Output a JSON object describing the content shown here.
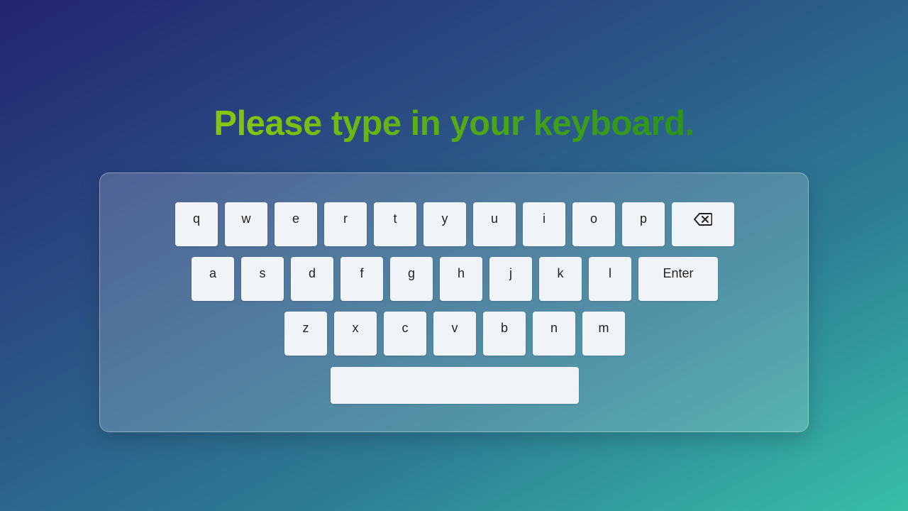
{
  "headline": "Please type in your keyboard.",
  "colors": {
    "headline_gradient_start": "#a6d60a",
    "headline_gradient_end": "#10801e",
    "key_background": "#f1f4f7",
    "key_text": "#222222"
  },
  "keyboard": {
    "row1": [
      "q",
      "w",
      "e",
      "r",
      "t",
      "y",
      "u",
      "i",
      "o",
      "p"
    ],
    "row2": [
      "a",
      "s",
      "d",
      "f",
      "g",
      "h",
      "j",
      "k",
      "l"
    ],
    "row3": [
      "z",
      "x",
      "c",
      "v",
      "b",
      "n",
      "m"
    ],
    "enter_label": "Enter",
    "backspace_icon": "backspace-icon",
    "space_label": ""
  }
}
